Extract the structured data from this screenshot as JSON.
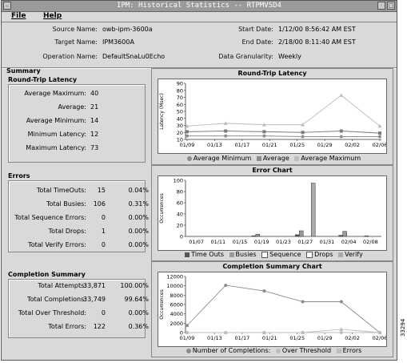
{
  "window": {
    "title": "IPM: Historical Statistics -- RTPMVSD4"
  },
  "menu": {
    "file": "File",
    "help": "Help"
  },
  "info": {
    "source_label": "Source Name:",
    "source": "owb-ipm-3600a",
    "target_label": "Target Name:",
    "target": "IPM3600A",
    "operation_label": "Operation Name:",
    "operation": "DefaultSnaLu0Echo",
    "start_label": "Start Date:",
    "start": "1/12/00 8:56:42 AM EST",
    "end_label": "End Date:",
    "end": "2/18/00 8:11:40 AM EST",
    "gran_label": "Data Granularity:",
    "gran": "Weekly"
  },
  "summary": {
    "title": "Summary",
    "rtl": {
      "title": "Round-Trip Latency",
      "rows": [
        {
          "label": "Average Maximum:",
          "value": "40"
        },
        {
          "label": "Average:",
          "value": "21"
        },
        {
          "label": "Average Minimum:",
          "value": "14"
        },
        {
          "label": "Minimum Latency:",
          "value": "12"
        },
        {
          "label": "Maximum Latency:",
          "value": "73"
        }
      ]
    },
    "errors": {
      "title": "Errors",
      "rows": [
        {
          "label": "Total TimeOuts:",
          "value": "15",
          "pct": "0.04%"
        },
        {
          "label": "Total Busies:",
          "value": "106",
          "pct": "0.31%"
        },
        {
          "label": "Total Sequence Errors:",
          "value": "0",
          "pct": "0.00%"
        },
        {
          "label": "Total Drops:",
          "value": "1",
          "pct": "0.00%"
        },
        {
          "label": "Total Verify Errors:",
          "value": "0",
          "pct": "0.00%"
        }
      ]
    },
    "completion": {
      "title": "Completion Summary",
      "rows": [
        {
          "label": "Total Attempts:",
          "value": "33,871",
          "pct": "100.00%"
        },
        {
          "label": "Total Completions:",
          "value": "33,749",
          "pct": "99.64%"
        },
        {
          "label": "Total Over Threshold:",
          "value": "0",
          "pct": "0.00%"
        },
        {
          "label": "Total Errors:",
          "value": "122",
          "pct": "0.36%"
        }
      ]
    }
  },
  "colors": {
    "bg": "#d9d9d9",
    "series1": "#8c8c8c",
    "series2": "#8c8c8c",
    "series3": "#bcbcbc"
  },
  "figure_id": "33294",
  "chart_data": [
    {
      "type": "line",
      "title": "Round-Trip Latency",
      "ylabel": "Latency (Msec)",
      "ylim": [
        10,
        90
      ],
      "yticks": [
        10,
        20,
        30,
        40,
        50,
        60,
        70,
        80,
        90
      ],
      "xticks": [
        "01/09",
        "01/13",
        "01/17",
        "01/21",
        "01/25",
        "01/29",
        "02/02",
        "02/06"
      ],
      "x": [
        0,
        2,
        4,
        6,
        8,
        10
      ],
      "series": [
        {
          "name": "Average Minimum",
          "values": [
            15,
            15,
            15,
            14,
            14,
            14
          ]
        },
        {
          "name": "Average",
          "values": [
            21,
            22,
            21,
            20,
            22,
            19
          ]
        },
        {
          "name": "Average Maximum",
          "values": [
            29,
            33,
            31,
            31,
            73,
            29
          ]
        }
      ]
    },
    {
      "type": "bar",
      "title": "Error Chart",
      "ylabel": "Occurrences",
      "ylim": [
        0,
        100
      ],
      "yticks": [
        0,
        20,
        40,
        60,
        80,
        100
      ],
      "categories": [
        "01/07",
        "01/11",
        "01/15",
        "01/19",
        "01/23",
        "01/27",
        "01/31",
        "02/04",
        "02/08"
      ],
      "series": [
        {
          "name": "Time Outs",
          "values": [
            0,
            0,
            0,
            1,
            0,
            3,
            0,
            2,
            0
          ]
        },
        {
          "name": "Busies",
          "values": [
            0,
            0,
            0,
            4,
            0,
            10,
            0,
            9,
            1
          ]
        },
        {
          "name": "Sequence",
          "values": [
            0,
            0,
            0,
            0,
            0,
            0,
            0,
            0,
            0
          ]
        },
        {
          "name": "Drops",
          "values": [
            0,
            0,
            0,
            0,
            0,
            0,
            0,
            0,
            0
          ]
        },
        {
          "name": "Verify",
          "values": [
            0,
            0,
            0,
            0,
            0,
            95,
            0,
            0,
            0
          ]
        }
      ]
    },
    {
      "type": "line",
      "title": "Completion Summary Chart",
      "ylabel": "Occurrences",
      "ylim": [
        0,
        12000
      ],
      "yticks": [
        0,
        2000,
        4000,
        6000,
        8000,
        10000,
        12000
      ],
      "xticks": [
        "01/09",
        "01/13",
        "01/17",
        "01/21",
        "01/25",
        "01/29",
        "02/02",
        "02/06"
      ],
      "x": [
        0,
        2,
        4,
        6,
        8,
        10
      ],
      "series": [
        {
          "name": "Number of Completions",
          "values": [
            1500,
            10100,
            8900,
            6600,
            6600,
            0
          ]
        },
        {
          "name": "Over Threshold",
          "values": [
            0,
            0,
            0,
            0,
            0,
            0
          ]
        },
        {
          "name": "Errors",
          "values": [
            0,
            0,
            0,
            0,
            700,
            0
          ]
        }
      ]
    }
  ]
}
